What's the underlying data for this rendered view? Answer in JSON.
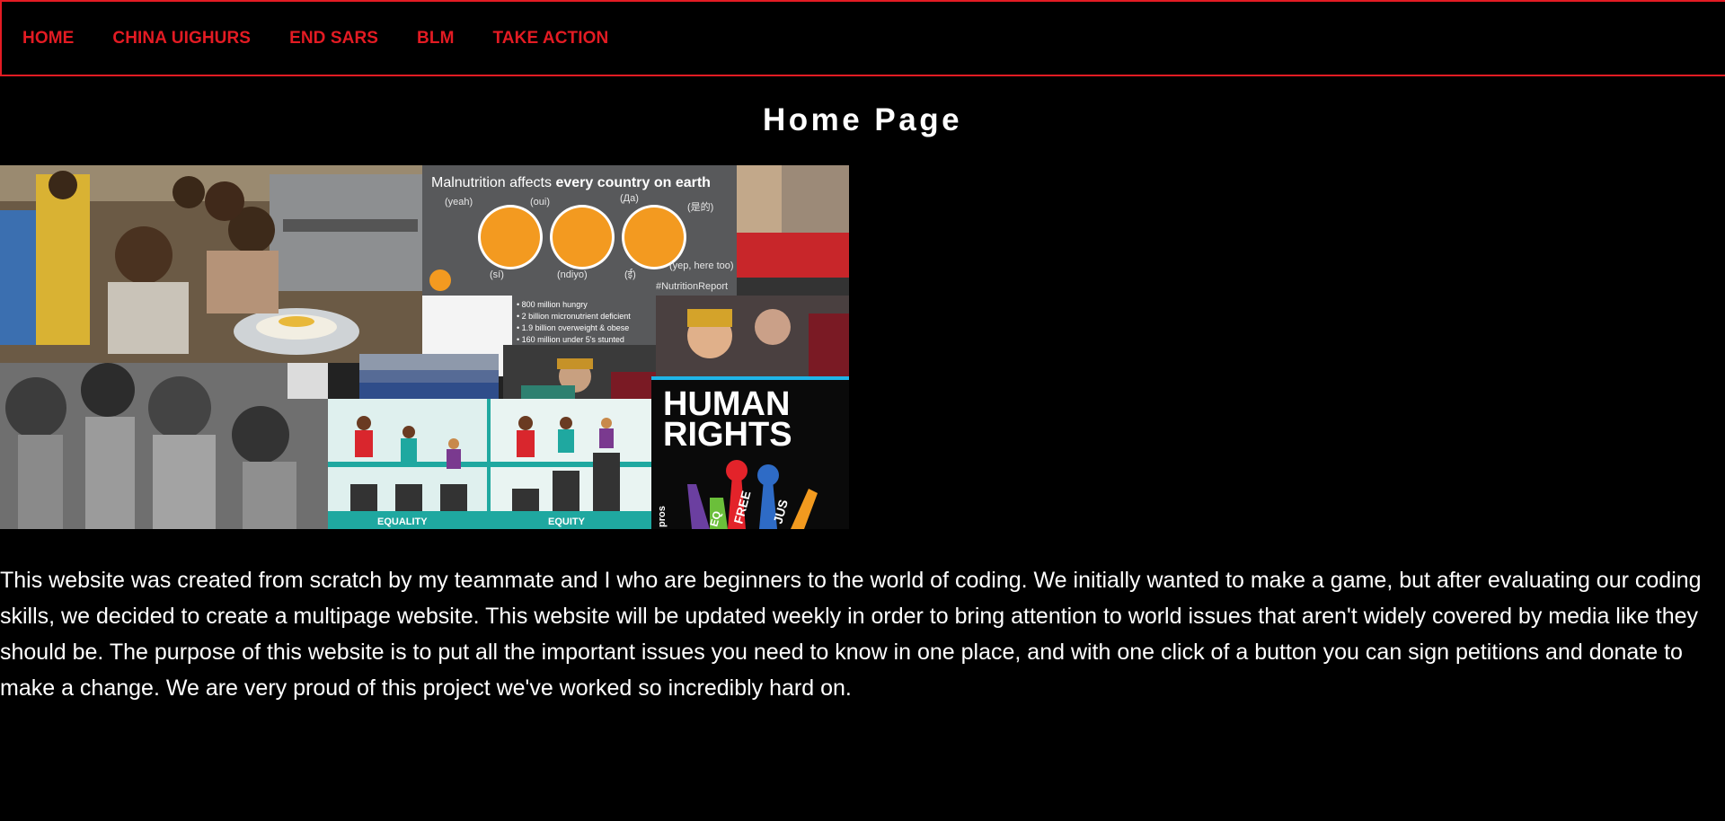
{
  "nav": {
    "items": [
      {
        "label": "HOME"
      },
      {
        "label": "CHINA UIGHURS"
      },
      {
        "label": "END SARS"
      },
      {
        "label": "BLM"
      },
      {
        "label": "TAKE ACTION"
      }
    ]
  },
  "page": {
    "title": "Home Page",
    "description": "This website was created from scratch by my teammate and I who are beginners to the world of coding. We initially wanted to make a game, but after evaluating our coding skills, we decided to create a multipage website. This website will be updated weekly in order to bring attention to world issues that aren't widely covered by media like they should be. The purpose of this website is to put all the important issues you need to know in one place, and with one click of a button you can sign petitions and donate to make a change. We are very proud of this project we've worked so incredibly hard on."
  },
  "collage": {
    "nutrition_title_a": "Malnutrition affects ",
    "nutrition_title_b": "every country on earth",
    "bubbles": [
      "(yeah)",
      "(oui)",
      "(Да)",
      "(是的)",
      "(sí)",
      "(ndiyo)",
      "(ई)",
      "(yep, here too)"
    ],
    "nutrition_tag": "#NutritionReport",
    "stats": [
      "• 800 million hungry",
      "• 2 billion micronutrient deficient",
      "• 1.9 billion overweight & obese",
      "• 160 million under 5's stunted"
    ],
    "equality_label": "EQUALITY",
    "equity_label": "EQUITY",
    "rights_line1": "HUMAN",
    "rights_line2": "RIGHTS",
    "hand_words": [
      "FREE",
      "JUS",
      "EQ",
      "pros"
    ]
  },
  "colors": {
    "background": "#000000",
    "accent_red": "#e31b23",
    "text_white": "#ffffff"
  }
}
